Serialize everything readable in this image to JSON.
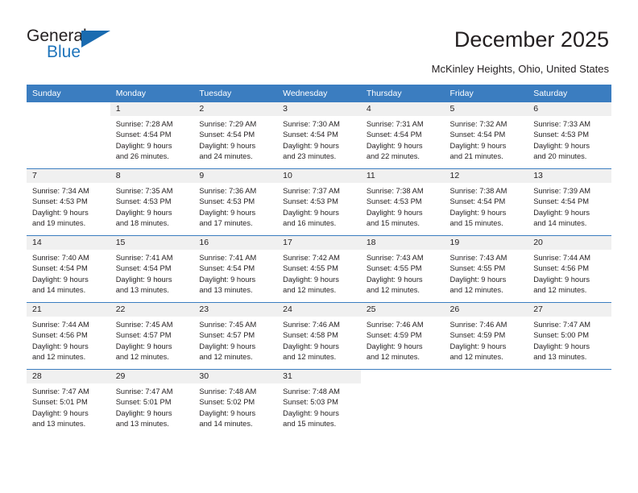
{
  "brand": {
    "name_top": "General",
    "name_bottom": "Blue",
    "accent_color": "#1e74bb"
  },
  "header": {
    "title": "December 2025",
    "subtitle": "McKinley Heights, Ohio, United States"
  },
  "theme": {
    "header_blue": "#3b7dc0",
    "day_band_gray": "#f0f0f0",
    "text": "#231f20"
  },
  "calendar": {
    "weekday_headers": [
      "Sunday",
      "Monday",
      "Tuesday",
      "Wednesday",
      "Thursday",
      "Friday",
      "Saturday"
    ],
    "weeks": [
      [
        {
          "day": "",
          "lines": []
        },
        {
          "day": "1",
          "lines": [
            "Sunrise: 7:28 AM",
            "Sunset: 4:54 PM",
            "Daylight: 9 hours",
            "and 26 minutes."
          ]
        },
        {
          "day": "2",
          "lines": [
            "Sunrise: 7:29 AM",
            "Sunset: 4:54 PM",
            "Daylight: 9 hours",
            "and 24 minutes."
          ]
        },
        {
          "day": "3",
          "lines": [
            "Sunrise: 7:30 AM",
            "Sunset: 4:54 PM",
            "Daylight: 9 hours",
            "and 23 minutes."
          ]
        },
        {
          "day": "4",
          "lines": [
            "Sunrise: 7:31 AM",
            "Sunset: 4:54 PM",
            "Daylight: 9 hours",
            "and 22 minutes."
          ]
        },
        {
          "day": "5",
          "lines": [
            "Sunrise: 7:32 AM",
            "Sunset: 4:54 PM",
            "Daylight: 9 hours",
            "and 21 minutes."
          ]
        },
        {
          "day": "6",
          "lines": [
            "Sunrise: 7:33 AM",
            "Sunset: 4:53 PM",
            "Daylight: 9 hours",
            "and 20 minutes."
          ]
        }
      ],
      [
        {
          "day": "7",
          "lines": [
            "Sunrise: 7:34 AM",
            "Sunset: 4:53 PM",
            "Daylight: 9 hours",
            "and 19 minutes."
          ]
        },
        {
          "day": "8",
          "lines": [
            "Sunrise: 7:35 AM",
            "Sunset: 4:53 PM",
            "Daylight: 9 hours",
            "and 18 minutes."
          ]
        },
        {
          "day": "9",
          "lines": [
            "Sunrise: 7:36 AM",
            "Sunset: 4:53 PM",
            "Daylight: 9 hours",
            "and 17 minutes."
          ]
        },
        {
          "day": "10",
          "lines": [
            "Sunrise: 7:37 AM",
            "Sunset: 4:53 PM",
            "Daylight: 9 hours",
            "and 16 minutes."
          ]
        },
        {
          "day": "11",
          "lines": [
            "Sunrise: 7:38 AM",
            "Sunset: 4:53 PM",
            "Daylight: 9 hours",
            "and 15 minutes."
          ]
        },
        {
          "day": "12",
          "lines": [
            "Sunrise: 7:38 AM",
            "Sunset: 4:54 PM",
            "Daylight: 9 hours",
            "and 15 minutes."
          ]
        },
        {
          "day": "13",
          "lines": [
            "Sunrise: 7:39 AM",
            "Sunset: 4:54 PM",
            "Daylight: 9 hours",
            "and 14 minutes."
          ]
        }
      ],
      [
        {
          "day": "14",
          "lines": [
            "Sunrise: 7:40 AM",
            "Sunset: 4:54 PM",
            "Daylight: 9 hours",
            "and 14 minutes."
          ]
        },
        {
          "day": "15",
          "lines": [
            "Sunrise: 7:41 AM",
            "Sunset: 4:54 PM",
            "Daylight: 9 hours",
            "and 13 minutes."
          ]
        },
        {
          "day": "16",
          "lines": [
            "Sunrise: 7:41 AM",
            "Sunset: 4:54 PM",
            "Daylight: 9 hours",
            "and 13 minutes."
          ]
        },
        {
          "day": "17",
          "lines": [
            "Sunrise: 7:42 AM",
            "Sunset: 4:55 PM",
            "Daylight: 9 hours",
            "and 12 minutes."
          ]
        },
        {
          "day": "18",
          "lines": [
            "Sunrise: 7:43 AM",
            "Sunset: 4:55 PM",
            "Daylight: 9 hours",
            "and 12 minutes."
          ]
        },
        {
          "day": "19",
          "lines": [
            "Sunrise: 7:43 AM",
            "Sunset: 4:55 PM",
            "Daylight: 9 hours",
            "and 12 minutes."
          ]
        },
        {
          "day": "20",
          "lines": [
            "Sunrise: 7:44 AM",
            "Sunset: 4:56 PM",
            "Daylight: 9 hours",
            "and 12 minutes."
          ]
        }
      ],
      [
        {
          "day": "21",
          "lines": [
            "Sunrise: 7:44 AM",
            "Sunset: 4:56 PM",
            "Daylight: 9 hours",
            "and 12 minutes."
          ]
        },
        {
          "day": "22",
          "lines": [
            "Sunrise: 7:45 AM",
            "Sunset: 4:57 PM",
            "Daylight: 9 hours",
            "and 12 minutes."
          ]
        },
        {
          "day": "23",
          "lines": [
            "Sunrise: 7:45 AM",
            "Sunset: 4:57 PM",
            "Daylight: 9 hours",
            "and 12 minutes."
          ]
        },
        {
          "day": "24",
          "lines": [
            "Sunrise: 7:46 AM",
            "Sunset: 4:58 PM",
            "Daylight: 9 hours",
            "and 12 minutes."
          ]
        },
        {
          "day": "25",
          "lines": [
            "Sunrise: 7:46 AM",
            "Sunset: 4:59 PM",
            "Daylight: 9 hours",
            "and 12 minutes."
          ]
        },
        {
          "day": "26",
          "lines": [
            "Sunrise: 7:46 AM",
            "Sunset: 4:59 PM",
            "Daylight: 9 hours",
            "and 12 minutes."
          ]
        },
        {
          "day": "27",
          "lines": [
            "Sunrise: 7:47 AM",
            "Sunset: 5:00 PM",
            "Daylight: 9 hours",
            "and 13 minutes."
          ]
        }
      ],
      [
        {
          "day": "28",
          "lines": [
            "Sunrise: 7:47 AM",
            "Sunset: 5:01 PM",
            "Daylight: 9 hours",
            "and 13 minutes."
          ]
        },
        {
          "day": "29",
          "lines": [
            "Sunrise: 7:47 AM",
            "Sunset: 5:01 PM",
            "Daylight: 9 hours",
            "and 13 minutes."
          ]
        },
        {
          "day": "30",
          "lines": [
            "Sunrise: 7:48 AM",
            "Sunset: 5:02 PM",
            "Daylight: 9 hours",
            "and 14 minutes."
          ]
        },
        {
          "day": "31",
          "lines": [
            "Sunrise: 7:48 AM",
            "Sunset: 5:03 PM",
            "Daylight: 9 hours",
            "and 15 minutes."
          ]
        },
        {
          "day": "",
          "lines": []
        },
        {
          "day": "",
          "lines": []
        },
        {
          "day": "",
          "lines": []
        }
      ]
    ]
  }
}
